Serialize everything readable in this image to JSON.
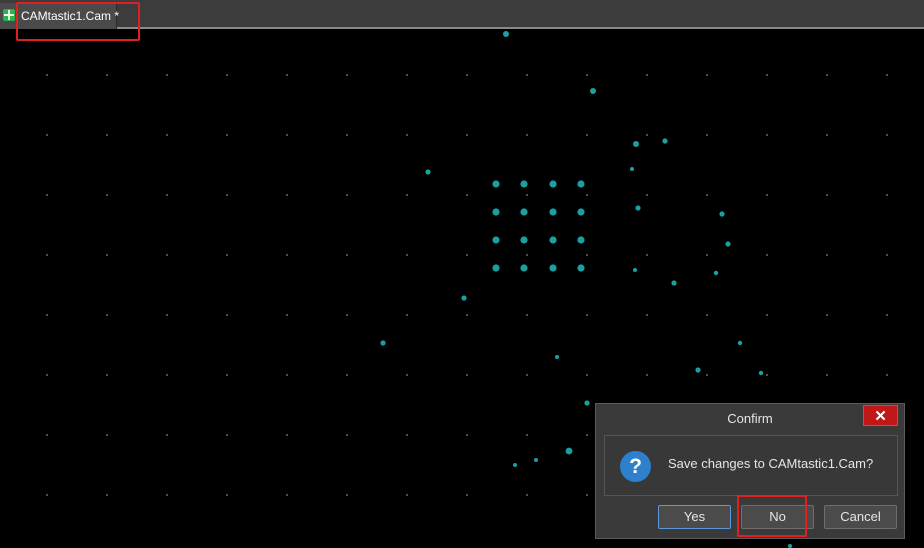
{
  "tab": {
    "title": "CAMtastic1.Cam *",
    "icon": "cam-document-icon"
  },
  "canvas": {
    "background": "#000000",
    "pad_color": "#1aa0a0",
    "grid_color": "#8a8a8a"
  },
  "dialog": {
    "title": "Confirm",
    "close_icon": "close-icon",
    "message_icon": "question-icon",
    "message": "Save changes to CAMtastic1.Cam?",
    "buttons": {
      "yes": "Yes",
      "no": "No",
      "cancel": "Cancel"
    }
  },
  "colors": {
    "highlight": "#e02020",
    "close_button": "#c01818",
    "question_icon": "#2f80cc"
  }
}
